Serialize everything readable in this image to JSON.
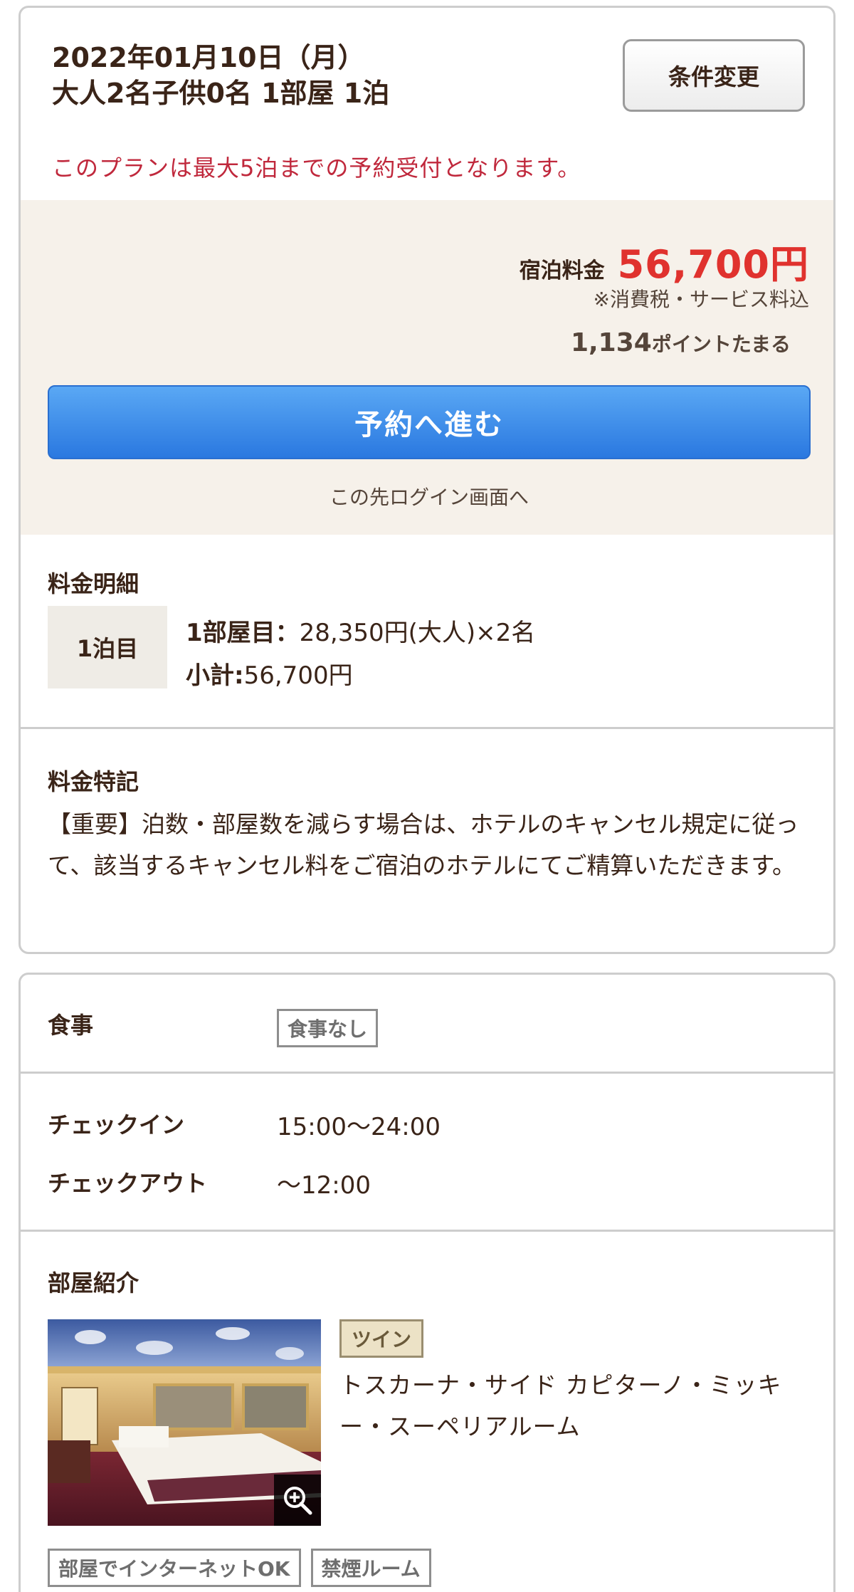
{
  "search": {
    "date_line": "2022年01月10日（月）",
    "guests_line": "大人2名子供0名 1部屋 1泊",
    "change_button": "条件変更"
  },
  "plan_note": "このプランは最大5泊までの予約受付となります。",
  "price": {
    "label": "宿泊料金",
    "amount": "56,700円",
    "tax_note": "※消費税・サービス料込",
    "points_number": "1,134",
    "points_label": "ポイントたまる",
    "reserve_button": "予約へ進む",
    "login_note": "この先ログイン画面へ",
    "accent_color": "#e0322e",
    "button_color": "#2a78e0"
  },
  "breakdown": {
    "title": "料金明細",
    "night_label": "1泊目",
    "room_label": "1部屋目：",
    "room_value": "28,350円(大人)×2名",
    "subtotal_label": "小計:",
    "subtotal_value": "56,700円"
  },
  "notes": {
    "title": "料金特記",
    "text": "【重要】泊数・部屋数を減らす場合は、ホテルのキャンセル規定に従って、該当するキャンセル料をご宿泊のホテルにてご精算いただきます。"
  },
  "details": {
    "meal_label": "食事",
    "meal_value": "食事なし",
    "checkin_label": "チェックイン",
    "checkin_value": "15:00〜24:00",
    "checkout_label": "チェックアウト",
    "checkout_value": "〜12:00"
  },
  "rooms": {
    "title": "部屋紹介",
    "photo_icon": "zoom-in-icon",
    "type_tag": "ツイン",
    "name": "トスカーナ・サイド カピターノ・ミッキー・スーペリアルーム",
    "features": [
      "部屋でインターネットOK",
      "禁煙ルーム"
    ]
  }
}
